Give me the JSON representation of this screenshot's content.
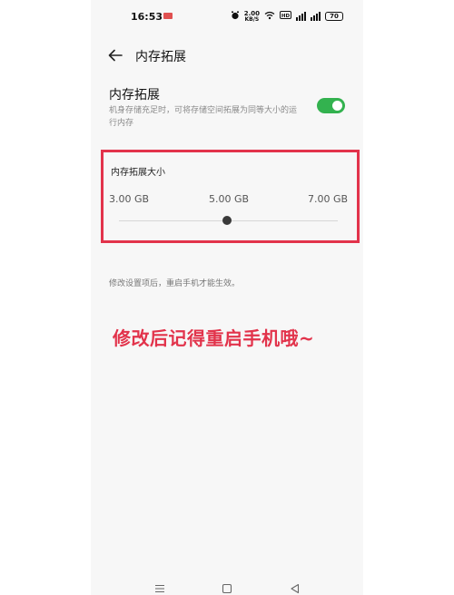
{
  "status_bar": {
    "time": "16:53",
    "net_speed_value": "2.00",
    "net_speed_unit": "KB/S",
    "hd_label": "HD",
    "battery_level": "70"
  },
  "header": {
    "title": "内存拓展"
  },
  "memory_extension": {
    "title": "内存拓展",
    "description": "机身存储充足时，可将存储空间拓展为同等大小的运行内存",
    "enabled": true
  },
  "size_card": {
    "title": "内存拓展大小",
    "options": [
      "3.00 GB",
      "5.00 GB",
      "7.00 GB"
    ],
    "selected": "5.00 GB",
    "highlight_color": "#e2334b"
  },
  "note": "修改设置项后，重启手机才能生效。",
  "overlay_caption": "修改后记得重启手机哦~",
  "colors": {
    "toggle_on": "#33b24f",
    "annotation_red": "#e2334b"
  },
  "nav_bar": {
    "icons": [
      "menu-icon",
      "home-icon",
      "back-triangle-icon"
    ]
  }
}
